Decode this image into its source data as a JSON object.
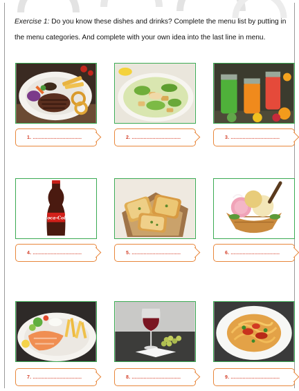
{
  "exercise": {
    "label": "Exercise 1:",
    "text": " Do you know these dishes and drinks? Complete the menu list by putting in the menu categories. And complete with your own idea into the last line in menu."
  },
  "cards": [
    {
      "image": "steak-plate",
      "answer": "1. ................................."
    },
    {
      "image": "caesar-salad",
      "answer": "2. ................................."
    },
    {
      "image": "fruit-juices",
      "answer": "3. ................................."
    },
    {
      "image": "coca-cola-bottle",
      "answer": "4. ................................."
    },
    {
      "image": "garlic-bread",
      "answer": "5. ................................."
    },
    {
      "image": "ice-cream-basket",
      "answer": "6. ................................."
    },
    {
      "image": "salmon-fries",
      "answer": "7. ................................."
    },
    {
      "image": "red-wine-glass",
      "answer": "8. ................................."
    },
    {
      "image": "spaghetti",
      "answer": "9. ................................."
    }
  ],
  "logo": {
    "text": "Coca-Cola"
  },
  "colors": {
    "card_border": "#3aaa52",
    "answer_border": "#e8863a",
    "answer_text": "#d4402a"
  }
}
